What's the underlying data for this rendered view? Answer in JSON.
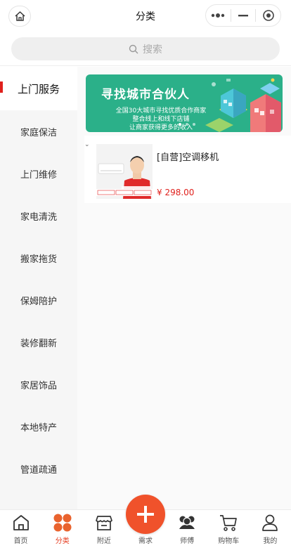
{
  "header": {
    "title": "分类",
    "home_icon": "home-icon",
    "menu_icon": "more-dots-icon",
    "minimize_icon": "minus-icon",
    "close_icon": "target-icon"
  },
  "search": {
    "placeholder": "搜索",
    "icon": "search-icon"
  },
  "sidebar": {
    "items": [
      {
        "label": "上门服务",
        "active": true
      },
      {
        "label": "家庭保洁"
      },
      {
        "label": "上门维修"
      },
      {
        "label": "家电清洗"
      },
      {
        "label": "搬家拖货"
      },
      {
        "label": "保姆陪护"
      },
      {
        "label": "装修翻新"
      },
      {
        "label": "家居饰品"
      },
      {
        "label": "本地特产"
      },
      {
        "label": "管道疏通"
      }
    ]
  },
  "banner": {
    "title": "寻找城市合伙人",
    "subtitle_lines": [
      "全国30大城市寻找优质合作商家",
      "整合线上和线下店铺",
      "让商家获得更多的收入"
    ],
    "colors": {
      "background": "#2bb089"
    }
  },
  "products": [
    {
      "name": "[自营]空调移机",
      "price": "¥ 298.00",
      "image_badges": [
        "快速上门",
        "专业服务",
        "收费透明"
      ]
    }
  ],
  "tabbar": {
    "items": [
      {
        "label": "首页",
        "icon": "home-icon"
      },
      {
        "label": "分类",
        "icon": "category-grid-icon",
        "active": true
      },
      {
        "label": "附近",
        "icon": "store-icon"
      },
      {
        "label": "需求",
        "icon": "plus-icon"
      },
      {
        "label": "师傅",
        "icon": "workers-icon"
      },
      {
        "label": "购物车",
        "icon": "cart-icon"
      },
      {
        "label": "我的",
        "icon": "user-icon"
      }
    ]
  },
  "colors": {
    "accent": "#e0201c",
    "tab_active": "#e53a1d",
    "plus_button": "#f0522b"
  }
}
